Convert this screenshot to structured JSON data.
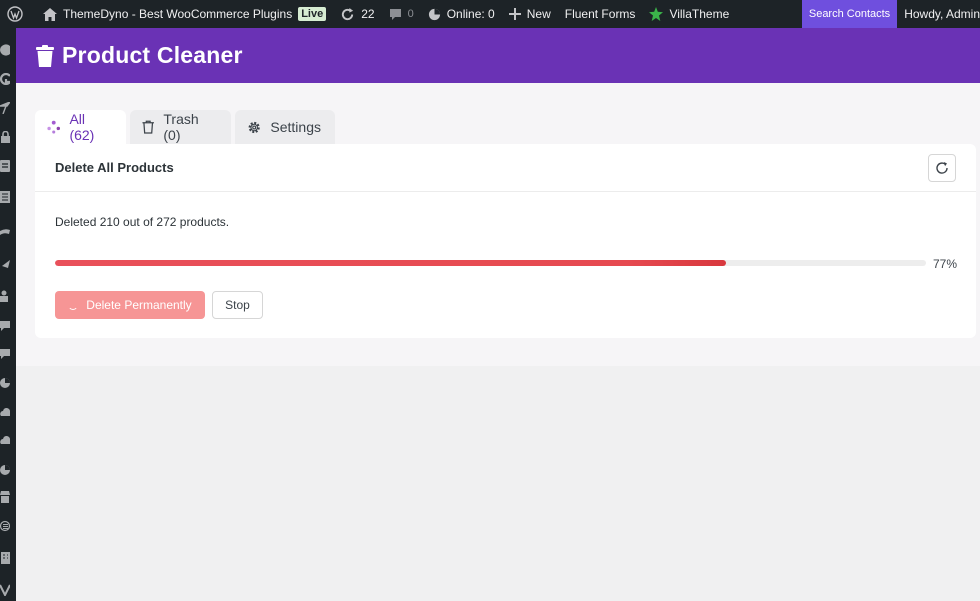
{
  "adminbar": {
    "site_name": "ThemeDyno - Best WooCommerce Plugins",
    "live_badge": "Live",
    "updates_count": "22",
    "comments_count": "0",
    "online": "Online: 0",
    "new_label": "New",
    "fluent_forms": "Fluent Forms",
    "villatheme": "VillaTheme",
    "search_contacts": "Search Contacts",
    "howdy": "Howdy, Admin"
  },
  "header": {
    "title": "Product Cleaner"
  },
  "tabs": [
    {
      "label": "All (62)",
      "icon": "sparkle-icon",
      "active": true
    },
    {
      "label": "Trash (0)",
      "icon": "trash-icon",
      "active": false
    },
    {
      "label": "Settings",
      "icon": "gear-icon",
      "active": false
    }
  ],
  "card": {
    "title": "Delete All Products",
    "status": "Deleted 210 out of 272 products.",
    "progress": 77,
    "progress_label": "77%",
    "delete_button": "Delete Permanently",
    "stop_button": "Stop"
  },
  "colors": {
    "header_bg": "#6a32b5",
    "accent": "#6a32b5",
    "progress_fill": "#e64a50",
    "delete_button_bg": "#f69595",
    "search_contacts_bg": "#6f4fde"
  }
}
